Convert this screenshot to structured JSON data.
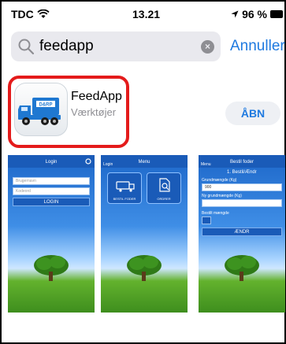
{
  "status_bar": {
    "carrier": "TDC",
    "time": "13.21",
    "battery": "96 %"
  },
  "search": {
    "value": "feedapp",
    "cancel_label": "Annuller"
  },
  "result": {
    "app_name": "FeedApp",
    "category": "Værktøjer",
    "open_label": "ÅBN",
    "icon_badge": "D&RP"
  },
  "screenshots": [
    {
      "title": "Login",
      "fields": [
        "Brugernavn",
        "Kodeord"
      ],
      "button": "LOGIN"
    },
    {
      "title": "Menu",
      "back": "Login",
      "tiles": [
        "BESTIL FODER",
        "ORDRER"
      ]
    },
    {
      "title": "Bestil foder",
      "back": "Menu",
      "heading": "1. Bestil/Ændr",
      "label_1": "Grundmængde (Kg)",
      "value_1": "900",
      "label_2": "Ny grundmængde (Kg)",
      "label_3": "Bestilt mængde",
      "button": "ÆNDR"
    }
  ]
}
